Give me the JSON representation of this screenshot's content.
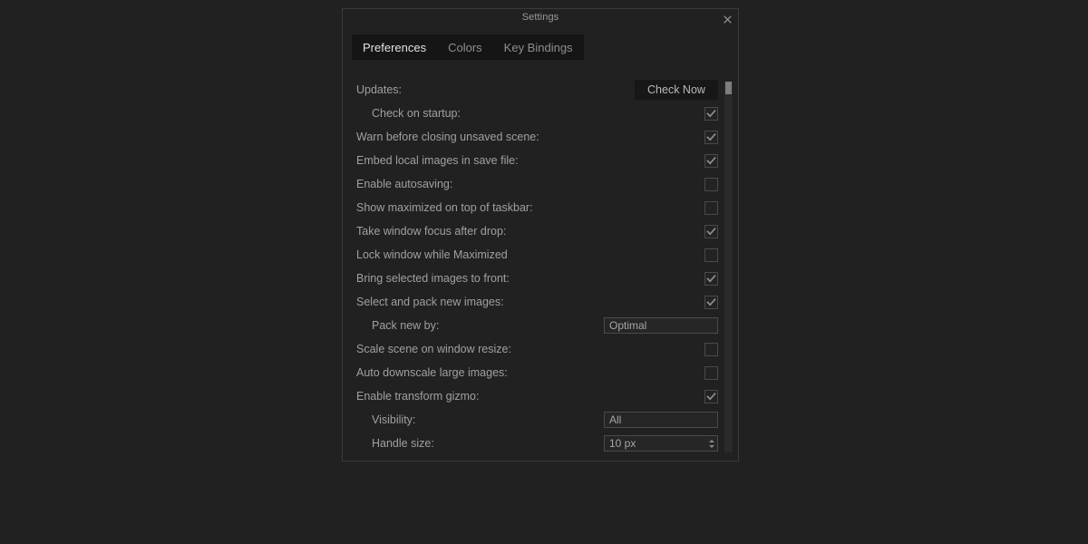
{
  "window": {
    "title": "Settings",
    "close_icon": "close-icon"
  },
  "tabs": [
    {
      "label": "Preferences",
      "active": true
    },
    {
      "label": "Colors",
      "active": false
    },
    {
      "label": "Key Bindings",
      "active": false
    }
  ],
  "settings": {
    "rows": [
      {
        "label": "Updates:",
        "indent": false,
        "control": "button",
        "value": "Check Now"
      },
      {
        "label": "Check on startup:",
        "indent": true,
        "control": "checkbox",
        "checked": true
      },
      {
        "label": "Warn before closing unsaved scene:",
        "indent": false,
        "control": "checkbox",
        "checked": true
      },
      {
        "label": "Embed local images in save file:",
        "indent": false,
        "control": "checkbox",
        "checked": true
      },
      {
        "label": "Enable autosaving:",
        "indent": false,
        "control": "checkbox",
        "checked": false
      },
      {
        "label": "Show maximized on top of taskbar:",
        "indent": false,
        "control": "checkbox",
        "checked": false
      },
      {
        "label": "Take window focus after drop:",
        "indent": false,
        "control": "checkbox",
        "checked": true
      },
      {
        "label": "Lock window while Maximized",
        "indent": false,
        "control": "checkbox",
        "checked": false
      },
      {
        "label": "Bring selected images to front:",
        "indent": false,
        "control": "checkbox",
        "checked": true
      },
      {
        "label": "Select and pack new images:",
        "indent": false,
        "control": "checkbox",
        "checked": true
      },
      {
        "label": "Pack new by:",
        "indent": true,
        "control": "combo",
        "value": "Optimal"
      },
      {
        "label": "Scale scene on window resize:",
        "indent": false,
        "control": "checkbox",
        "checked": false
      },
      {
        "label": "Auto downscale large images:",
        "indent": false,
        "control": "checkbox",
        "checked": false
      },
      {
        "label": "Enable transform gizmo:",
        "indent": false,
        "control": "checkbox",
        "checked": true
      },
      {
        "label": "Visibility:",
        "indent": true,
        "control": "combo",
        "value": "All"
      },
      {
        "label": "Handle size:",
        "indent": true,
        "control": "spinbox",
        "value": "10 px"
      }
    ]
  },
  "scrollbar": {
    "name": "preferences-scrollbar",
    "thumb_position_percent": 0,
    "thumb_size_percent": 3
  },
  "colors": {
    "app_background": "#212121",
    "dialog_background": "#212121",
    "dialog_border": "#3a3a3a",
    "tabbar_background": "#151515",
    "active_tab_text": "#e2e2e2",
    "inactive_tab_text": "#8f8f8f",
    "label_text": "#a0a0a0",
    "button_background": "#171717",
    "field_background": "#262626",
    "field_border": "#4a4a4a",
    "scrollbar_track": "#2a2a2a",
    "scrollbar_thumb": "#7e7e7e",
    "checkmark": "#8e8e8e"
  }
}
